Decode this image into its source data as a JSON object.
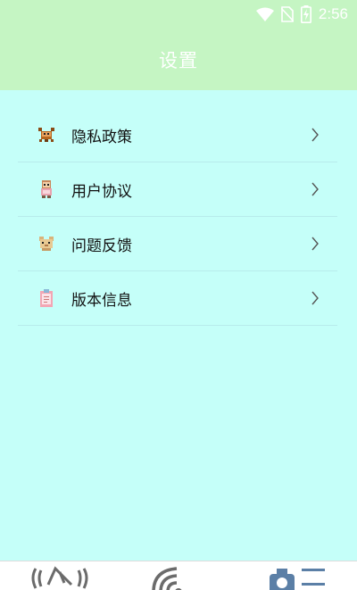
{
  "status_bar": {
    "time": "2:56",
    "icons": [
      "wifi-icon",
      "no-sim-icon",
      "battery-charging-icon"
    ]
  },
  "header": {
    "title": "设置"
  },
  "menu": {
    "items": [
      {
        "label": "隐私政策",
        "icon": "crab-icon"
      },
      {
        "label": "用户协议",
        "icon": "person-icon"
      },
      {
        "label": "问题反馈",
        "icon": "animal-icon"
      },
      {
        "label": "版本信息",
        "icon": "clipboard-icon"
      }
    ]
  },
  "bottom_nav": {
    "tabs": [
      "satellite-dish-tab-icon",
      "signal-tab-icon",
      "settings-tab-icon"
    ],
    "active_color": "#5b7fa6"
  },
  "colors": {
    "header_bg": "#c5f5c3",
    "page_bg": "#c5fff9",
    "divider": "#b8ecec"
  }
}
